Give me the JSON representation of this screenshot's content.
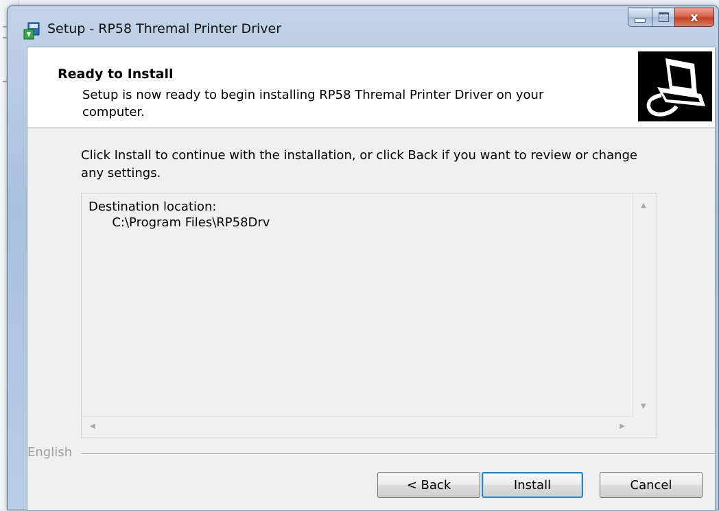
{
  "window": {
    "title": "Setup - RP58 Thremal Printer Driver",
    "close_glyph": "x",
    "icons": {
      "app": "setup-installer-icon",
      "minimize": "minimize-icon",
      "maximize": "maximize-icon",
      "close": "close-icon"
    }
  },
  "header": {
    "title": "Ready to Install",
    "description": "Setup is now ready to begin installing RP58 Thremal Printer Driver on your computer.",
    "image": "computer-installer-icon"
  },
  "body": {
    "intro": "Click Install to continue with the installation, or click Back if you want to review or change any settings."
  },
  "memo": {
    "heading": "Destination location:",
    "path": "      C:\\Program Files\\RP58Drv",
    "scroll_up": "▲",
    "scroll_down": "▼",
    "scroll_left": "◀",
    "scroll_right": "▶"
  },
  "footer": {
    "language": "English"
  },
  "buttons": {
    "back": "< Back",
    "install": "Install",
    "cancel": "Cancel"
  },
  "colors": {
    "titlebar": "#b9cde5",
    "close_button": "#c4432a",
    "default_button_border": "#3c7fb1",
    "client_background": "#f0f0f0"
  }
}
